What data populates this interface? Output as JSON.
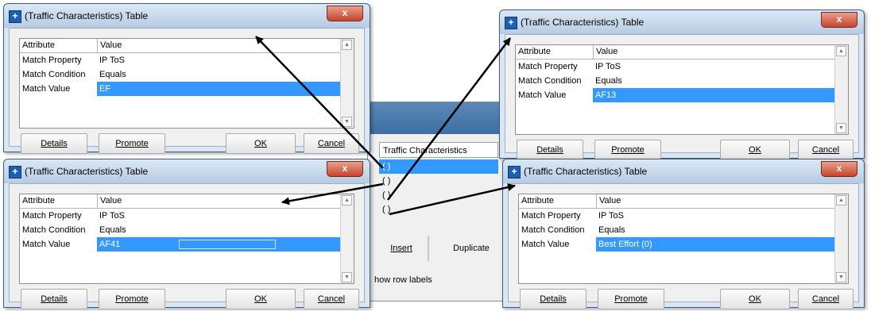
{
  "background": {
    "header_label": "Traffic Characteristics",
    "rows": [
      "( )",
      "( )",
      "( )",
      "( )"
    ],
    "insert_label": "Insert",
    "duplicate_label": "Duplicate",
    "show_row_labels": "how row labels"
  },
  "dialogs": [
    {
      "id": "top-left",
      "title": "(Traffic Characteristics) Table",
      "columns": [
        "Attribute",
        "Value"
      ],
      "rows": [
        {
          "attr": "Match Property",
          "value": "IP ToS"
        },
        {
          "attr": "Match Condition",
          "value": "Equals"
        },
        {
          "attr": "Match Value",
          "value": "EF"
        }
      ],
      "buttons": {
        "details": "Details",
        "promote": "Promote",
        "ok": "OK",
        "cancel": "Cancel"
      }
    },
    {
      "id": "bottom-left",
      "title": "(Traffic Characteristics) Table",
      "columns": [
        "Attribute",
        "Value"
      ],
      "rows": [
        {
          "attr": "Match Property",
          "value": "IP ToS"
        },
        {
          "attr": "Match Condition",
          "value": "Equals"
        },
        {
          "attr": "Match Value",
          "value": "AF41"
        }
      ],
      "buttons": {
        "details": "Details",
        "promote": "Promote",
        "ok": "OK",
        "cancel": "Cancel"
      }
    },
    {
      "id": "top-right",
      "title": "(Traffic Characteristics) Table",
      "columns": [
        "Attribute",
        "Value"
      ],
      "rows": [
        {
          "attr": "Match Property",
          "value": "IP ToS"
        },
        {
          "attr": "Match Condition",
          "value": "Equals"
        },
        {
          "attr": "Match Value",
          "value": "AF13"
        }
      ],
      "buttons": {
        "details": "Details",
        "promote": "Promote",
        "ok": "OK",
        "cancel": "Cancel"
      }
    },
    {
      "id": "bottom-right",
      "title": "(Traffic Characteristics) Table",
      "columns": [
        "Attribute",
        "Value"
      ],
      "rows": [
        {
          "attr": "Match Property",
          "value": "IP ToS"
        },
        {
          "attr": "Match Condition",
          "value": "Equals"
        },
        {
          "attr": "Match Value",
          "value": "Best Effort (0)"
        }
      ],
      "buttons": {
        "details": "Details",
        "promote": "Promote",
        "ok": "OK",
        "cancel": "Cancel"
      }
    }
  ],
  "close_glyph": "x",
  "colors": {
    "selection": "#3399ff",
    "arrow": "#000000"
  }
}
